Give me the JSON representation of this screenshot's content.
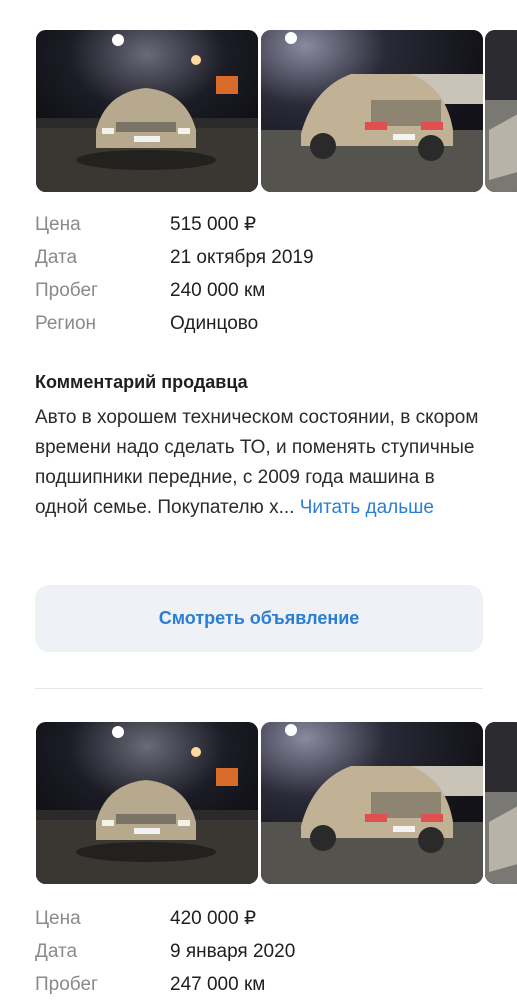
{
  "listings": [
    {
      "specs": [
        {
          "label": "Цена",
          "value": "515 000 ₽"
        },
        {
          "label": "Дата",
          "value": "21 октября 2019"
        },
        {
          "label": "Пробег",
          "value": "240 000 км"
        },
        {
          "label": "Регион",
          "value": "Одинцово"
        }
      ],
      "comment_title": "Комментарий продавца",
      "comment_text": "Авто в хорошем техническом состоянии, в скором времени надо сделать ТО, и поменять ступичные подшипники передние, с 2009 года машина в одной семье. Покупателю х...",
      "read_more": "Читать дальше",
      "view_button": "Смотреть объявление"
    },
    {
      "specs": [
        {
          "label": "Цена",
          "value": "420 000 ₽"
        },
        {
          "label": "Дата",
          "value": "9 января 2020"
        },
        {
          "label": "Пробег",
          "value": "247 000 км"
        }
      ]
    }
  ],
  "colors": {
    "link": "#2a7fd4",
    "label": "#8a8a8a",
    "button_bg": "#eef1f5"
  }
}
